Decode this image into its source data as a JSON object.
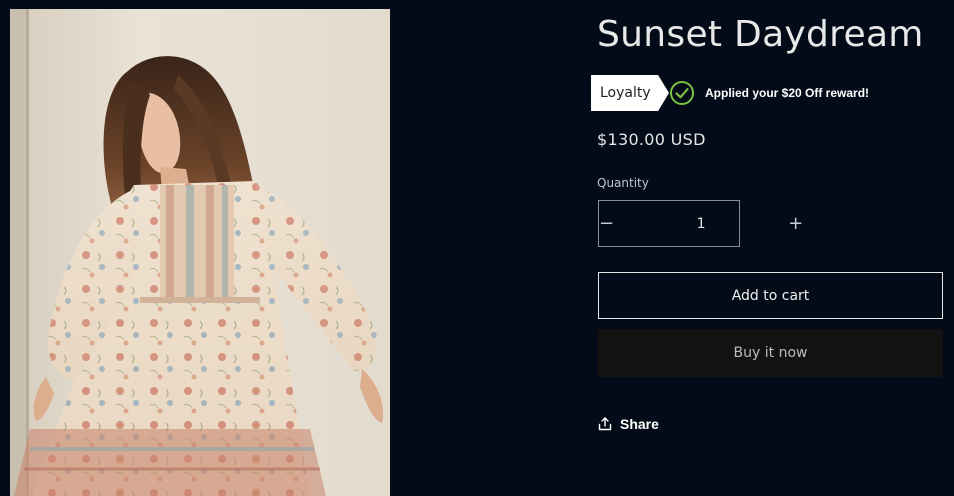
{
  "product": {
    "title": "Sunset Daydream",
    "price": "$130.00 USD"
  },
  "loyalty": {
    "tag_label": "Loyalty",
    "message": "Applied your $20 Off reward!",
    "check_color": "#7bc142"
  },
  "quantity": {
    "label": "Quantity",
    "value": "1",
    "decrement_symbol": "−",
    "increment_symbol": "+"
  },
  "actions": {
    "add_to_cart": "Add to cart",
    "buy_now": "Buy it now",
    "share": "Share"
  },
  "colors": {
    "background": "#020b17",
    "buy_now_bg": "#121212",
    "text": "#e6e6e6"
  },
  "icons": {
    "check": "check-circle-icon",
    "share": "share-icon"
  }
}
